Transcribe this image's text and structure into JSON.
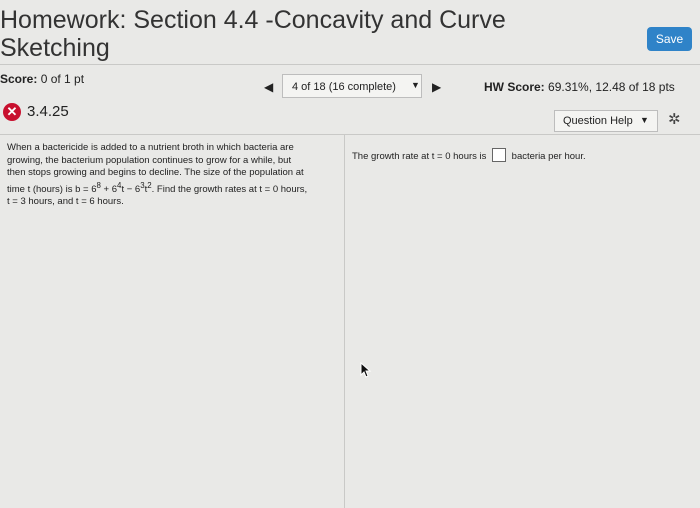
{
  "header": {
    "title_line1": "Homework: Section 4.4 -Concavity and Curve",
    "title_line2": "Sketching",
    "save_label": "Save"
  },
  "status": {
    "score_label": "Score:",
    "score_value": "0 of 1 pt",
    "progress": "4 of 18 (16 complete)",
    "hw_score_label": "HW Score:",
    "hw_score_value": "69.31%, 12.48 of 18 pts"
  },
  "question": {
    "number": "3.4.25",
    "help_label": "Question Help",
    "prompt_line1": "When a bactericide is added to a nutrient broth in which bacteria are",
    "prompt_line2": "growing, the bacterium population continues to grow for a while, but",
    "prompt_line3": "then stops growing and begins to decline. The size of the population at",
    "prompt_line4a": "time t (hours) is b = 6",
    "exp_8": "8",
    "prompt_line4b": " + 6",
    "exp_4": "4",
    "prompt_line4c": "t − 6",
    "exp_3": "3",
    "prompt_line4d": "t",
    "exp_2": "2",
    "prompt_line4e": ". Find the growth rates at t = 0 hours,",
    "prompt_line5": "t = 3 hours, and t = 6 hours.",
    "answer_before": "The growth rate at t = 0 hours is",
    "answer_after": "bacteria per hour."
  },
  "icons": {
    "error": "x-circle-icon",
    "settings": "gear-icon",
    "prev": "triangle-left-icon",
    "next": "triangle-right-icon"
  },
  "colors": {
    "save_button": "#2f83c8",
    "error_icon": "#c8102e"
  }
}
